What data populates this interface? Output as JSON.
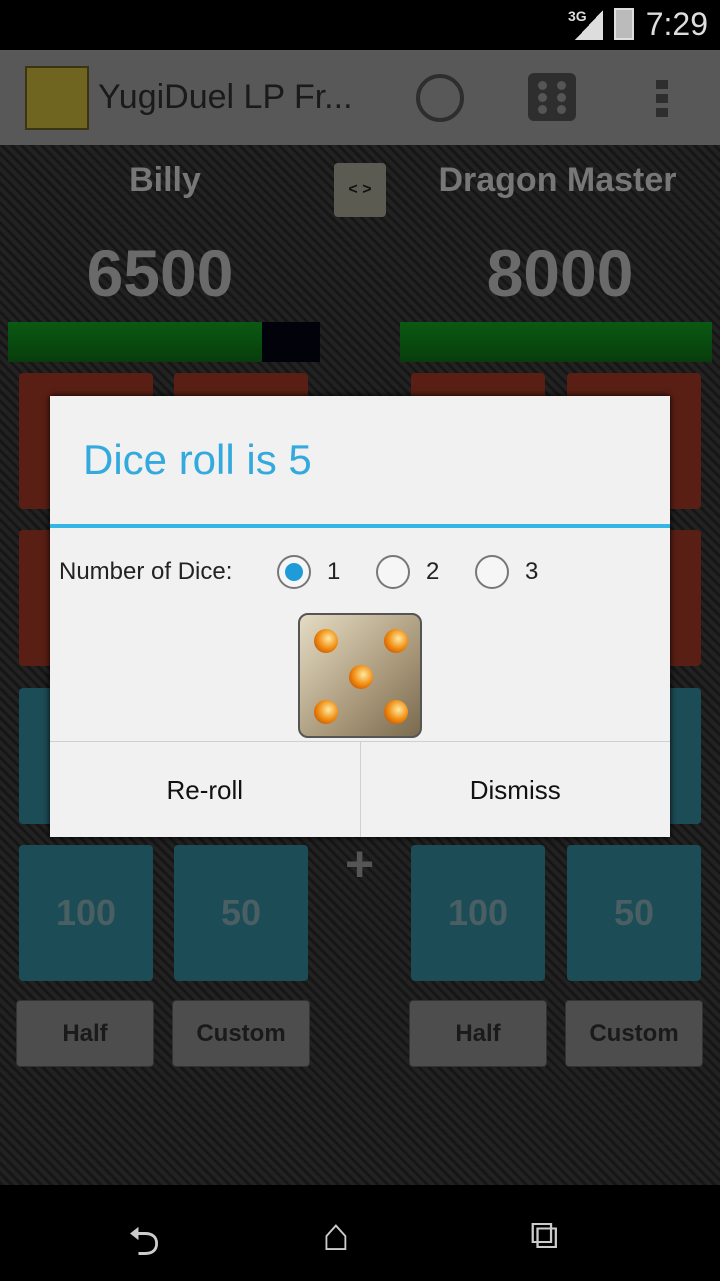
{
  "status_bar": {
    "network": "3G",
    "time": "7:29"
  },
  "action_bar": {
    "title": "YugiDuel LP Fr...",
    "icons": [
      "app-logo",
      "profile-icon",
      "dice-icon",
      "overflow-menu-icon"
    ]
  },
  "players": [
    {
      "name": "Billy",
      "life_points": "6500",
      "life_fraction": 0.8125,
      "buttons": {
        "row3": [
          "100",
          "50"
        ],
        "half": "Half",
        "custom": "Custom"
      }
    },
    {
      "name": "Dragon Master",
      "life_points": "8000",
      "life_fraction": 1.0,
      "buttons": {
        "row3": [
          "100",
          "50"
        ],
        "half": "Half",
        "custom": "Custom"
      }
    }
  ],
  "swap_label": "< >",
  "dialog": {
    "title": "Dice roll is 5",
    "number_label": "Number of Dice:",
    "options": [
      "1",
      "2",
      "3"
    ],
    "selected": "1",
    "die_value": 5,
    "reroll": "Re-roll",
    "dismiss": "Dismiss"
  },
  "colors": {
    "accent": "#33b5e5",
    "life_bar": "#0a5a12"
  }
}
